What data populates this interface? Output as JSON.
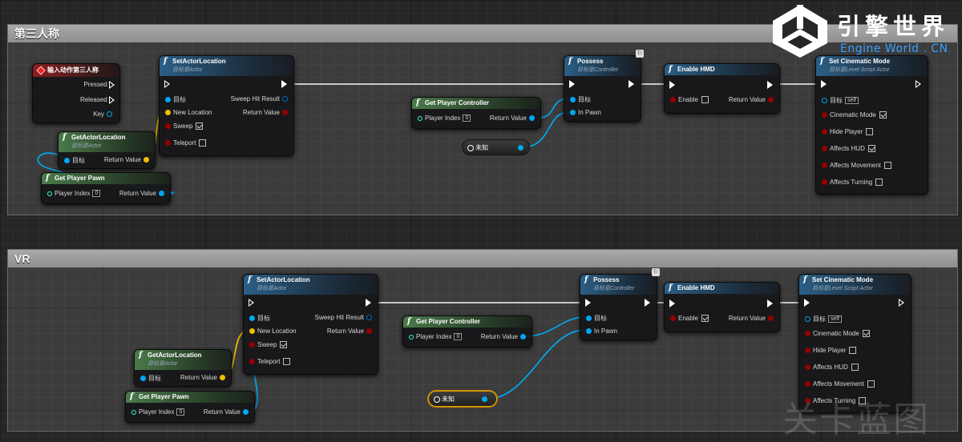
{
  "comments": {
    "third_person": "第三人称",
    "vr": "VR"
  },
  "logo": {
    "title": "引擎世界",
    "subtitle": "Engine World . CN"
  },
  "watermark": "关卡蓝图",
  "input_action": {
    "title": "输入动作第三人称",
    "pressed": "Pressed",
    "released": "Released",
    "key": "Key"
  },
  "set_actor_location": {
    "title": "SetActorLocation",
    "subtitle": "目标是Actor",
    "target": "目标",
    "sweep_hit_result": "Sweep Hit Result",
    "new_location": "New Location",
    "return_value": "Return Value",
    "sweep": "Sweep",
    "teleport": "Teleport"
  },
  "get_actor_location": {
    "title": "GetActorLocation",
    "subtitle": "目标是Actor",
    "target": "目标",
    "return_value": "Return Value"
  },
  "get_player_pawn": {
    "title": "Get Player Pawn",
    "player_index": "Player Index",
    "index_value": "0",
    "return_value": "Return Value"
  },
  "get_player_controller": {
    "title": "Get Player Controller",
    "player_index": "Player Index",
    "index_value": "0",
    "return_value": "Return Value"
  },
  "possess": {
    "title": "Possess",
    "subtitle": "目标是Controller",
    "target": "目标",
    "in_pawn": "In Pawn"
  },
  "enable_hmd": {
    "title": "Enable HMD",
    "enable": "Enable",
    "return_value": "Return Value"
  },
  "set_cinematic_mode": {
    "title": "Set Cinematic Mode",
    "subtitle": "目标是Level Script Actor",
    "target": "目标",
    "self": "self",
    "cinematic_mode": "Cinematic Mode",
    "hide_player": "Hide Player",
    "affects_hud": "Affects HUD",
    "affects_movement": "Affects Movement",
    "affects_turning": "Affects Turning"
  },
  "unknown_var": "未知",
  "state": {
    "third_person": {
      "sweep": true,
      "teleport": false,
      "enable_hmd": false,
      "cinematic": true,
      "hide_player": false,
      "affects_hud": true,
      "affects_movement": false,
      "affects_turning": false
    },
    "vr": {
      "sweep": true,
      "teleport": false,
      "enable_hmd": true,
      "cinematic": true,
      "hide_player": false,
      "affects_hud": false,
      "affects_movement": false,
      "affects_turning": false
    }
  },
  "colors": {
    "exec": "#ffffff",
    "object_pin": "#00a8f0",
    "vector_pin": "#f0c000",
    "struct_pin": "#0070d0",
    "bool_pin": "#950000",
    "int_pin": "#1fe0b0",
    "selection": "#e0a000"
  }
}
